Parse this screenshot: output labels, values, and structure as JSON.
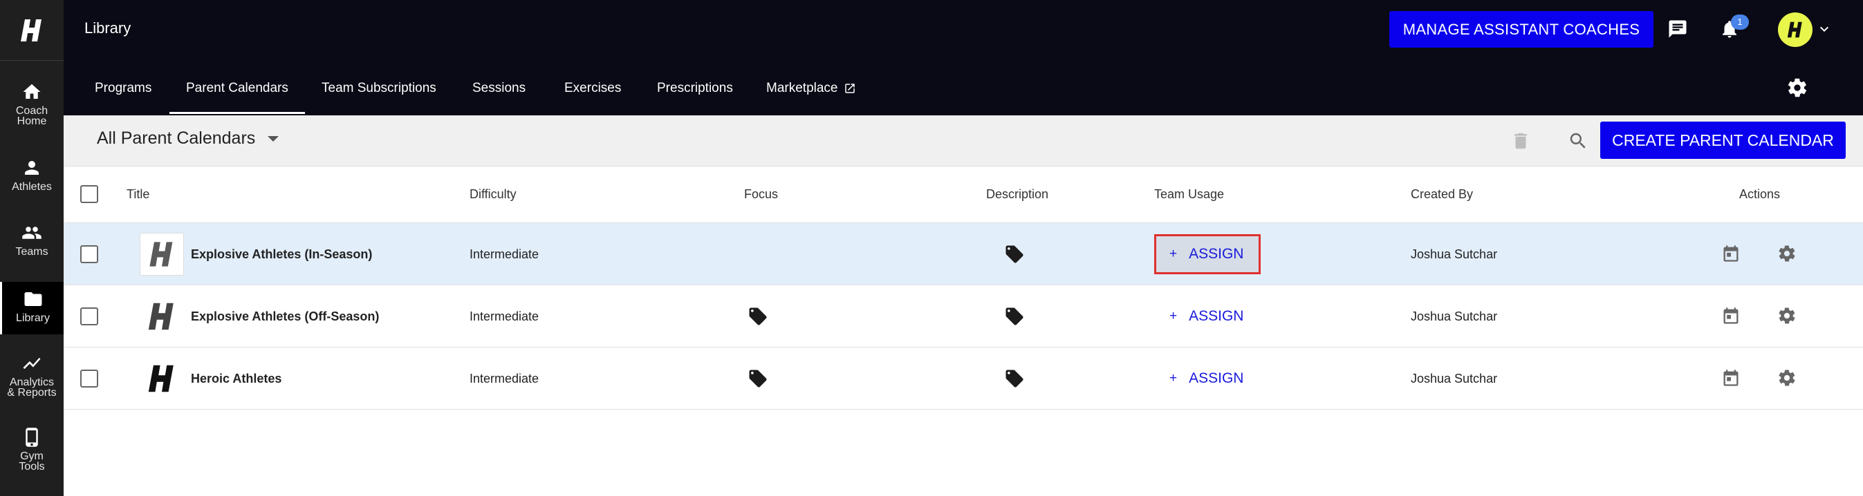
{
  "app": {
    "title": "Library",
    "logo": "H"
  },
  "sidebar": {
    "items": [
      {
        "icon": "home-icon",
        "label_line1": "Coach",
        "label_line2": "Home"
      },
      {
        "icon": "person-icon",
        "label_line1": "Athletes",
        "label_line2": ""
      },
      {
        "icon": "group-icon",
        "label_line1": "Teams",
        "label_line2": ""
      },
      {
        "icon": "folder-icon",
        "label_line1": "Library",
        "label_line2": ""
      },
      {
        "icon": "trending-icon",
        "label_line1": "Analytics",
        "label_line2": "& Reports"
      },
      {
        "icon": "phone-icon",
        "label_line1": "Gym",
        "label_line2": "Tools"
      }
    ]
  },
  "header": {
    "manage_button": "MANAGE ASSISTANT COACHES",
    "notification_count": "1",
    "avatar_letter": "H"
  },
  "tabs": [
    {
      "label": "Programs",
      "active": false
    },
    {
      "label": "Parent Calendars",
      "active": true
    },
    {
      "label": "Team Subscriptions",
      "active": false
    },
    {
      "label": "Sessions",
      "active": false
    },
    {
      "label": "Exercises",
      "active": false
    },
    {
      "label": "Prescriptions",
      "active": false
    },
    {
      "label": "Marketplace",
      "active": false
    }
  ],
  "toolbar": {
    "filter_label": "All Parent Calendars",
    "create_button": "CREATE PARENT CALENDAR"
  },
  "table": {
    "columns": [
      "Title",
      "Difficulty",
      "Focus",
      "Description",
      "Team Usage",
      "Created By",
      "Actions"
    ],
    "assign_label": "ASSIGN",
    "assign_plus": "+",
    "rows": [
      {
        "title": "Explosive Athletes (In-Season)",
        "difficulty": "Intermediate",
        "focus_tag": false,
        "description_tag": true,
        "created_by": "Joshua Sutchar",
        "highlighted": true
      },
      {
        "title": "Explosive Athletes (Off-Season)",
        "difficulty": "Intermediate",
        "focus_tag": true,
        "description_tag": true,
        "created_by": "Joshua Sutchar",
        "highlighted": false
      },
      {
        "title": "Heroic Athletes",
        "difficulty": "Intermediate",
        "focus_tag": true,
        "description_tag": true,
        "created_by": "Joshua Sutchar",
        "highlighted": false
      }
    ]
  },
  "colors": {
    "accent": "#0a00ee",
    "header_bg": "#0a0a16",
    "sidebar_bg": "#1f1f1f",
    "highlight_row": "#e2eefa",
    "annotation_box": "#e03030"
  }
}
